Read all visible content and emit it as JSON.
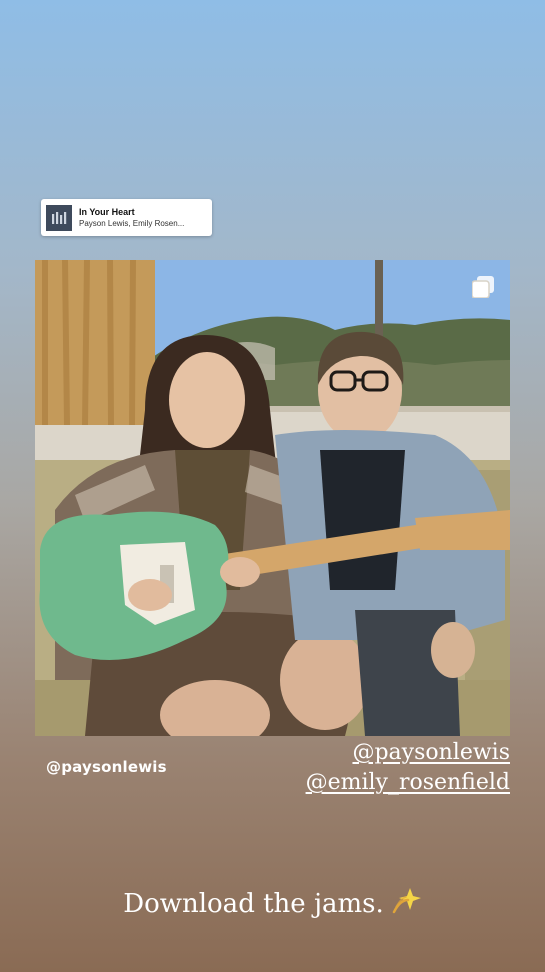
{
  "music_sticker": {
    "title": "In Your Heart",
    "artist": "Payson Lewis, Emily Rosen...",
    "icon": "album-art-icon"
  },
  "post": {
    "author": "@paysonlewis",
    "icon": "multiple-posts-icon"
  },
  "mentions": [
    "@paysonlewis",
    "@emily_rosenfield"
  ],
  "caption": {
    "text": "Download the jams.",
    "icon": "dizzy-sparkle-emoji"
  }
}
